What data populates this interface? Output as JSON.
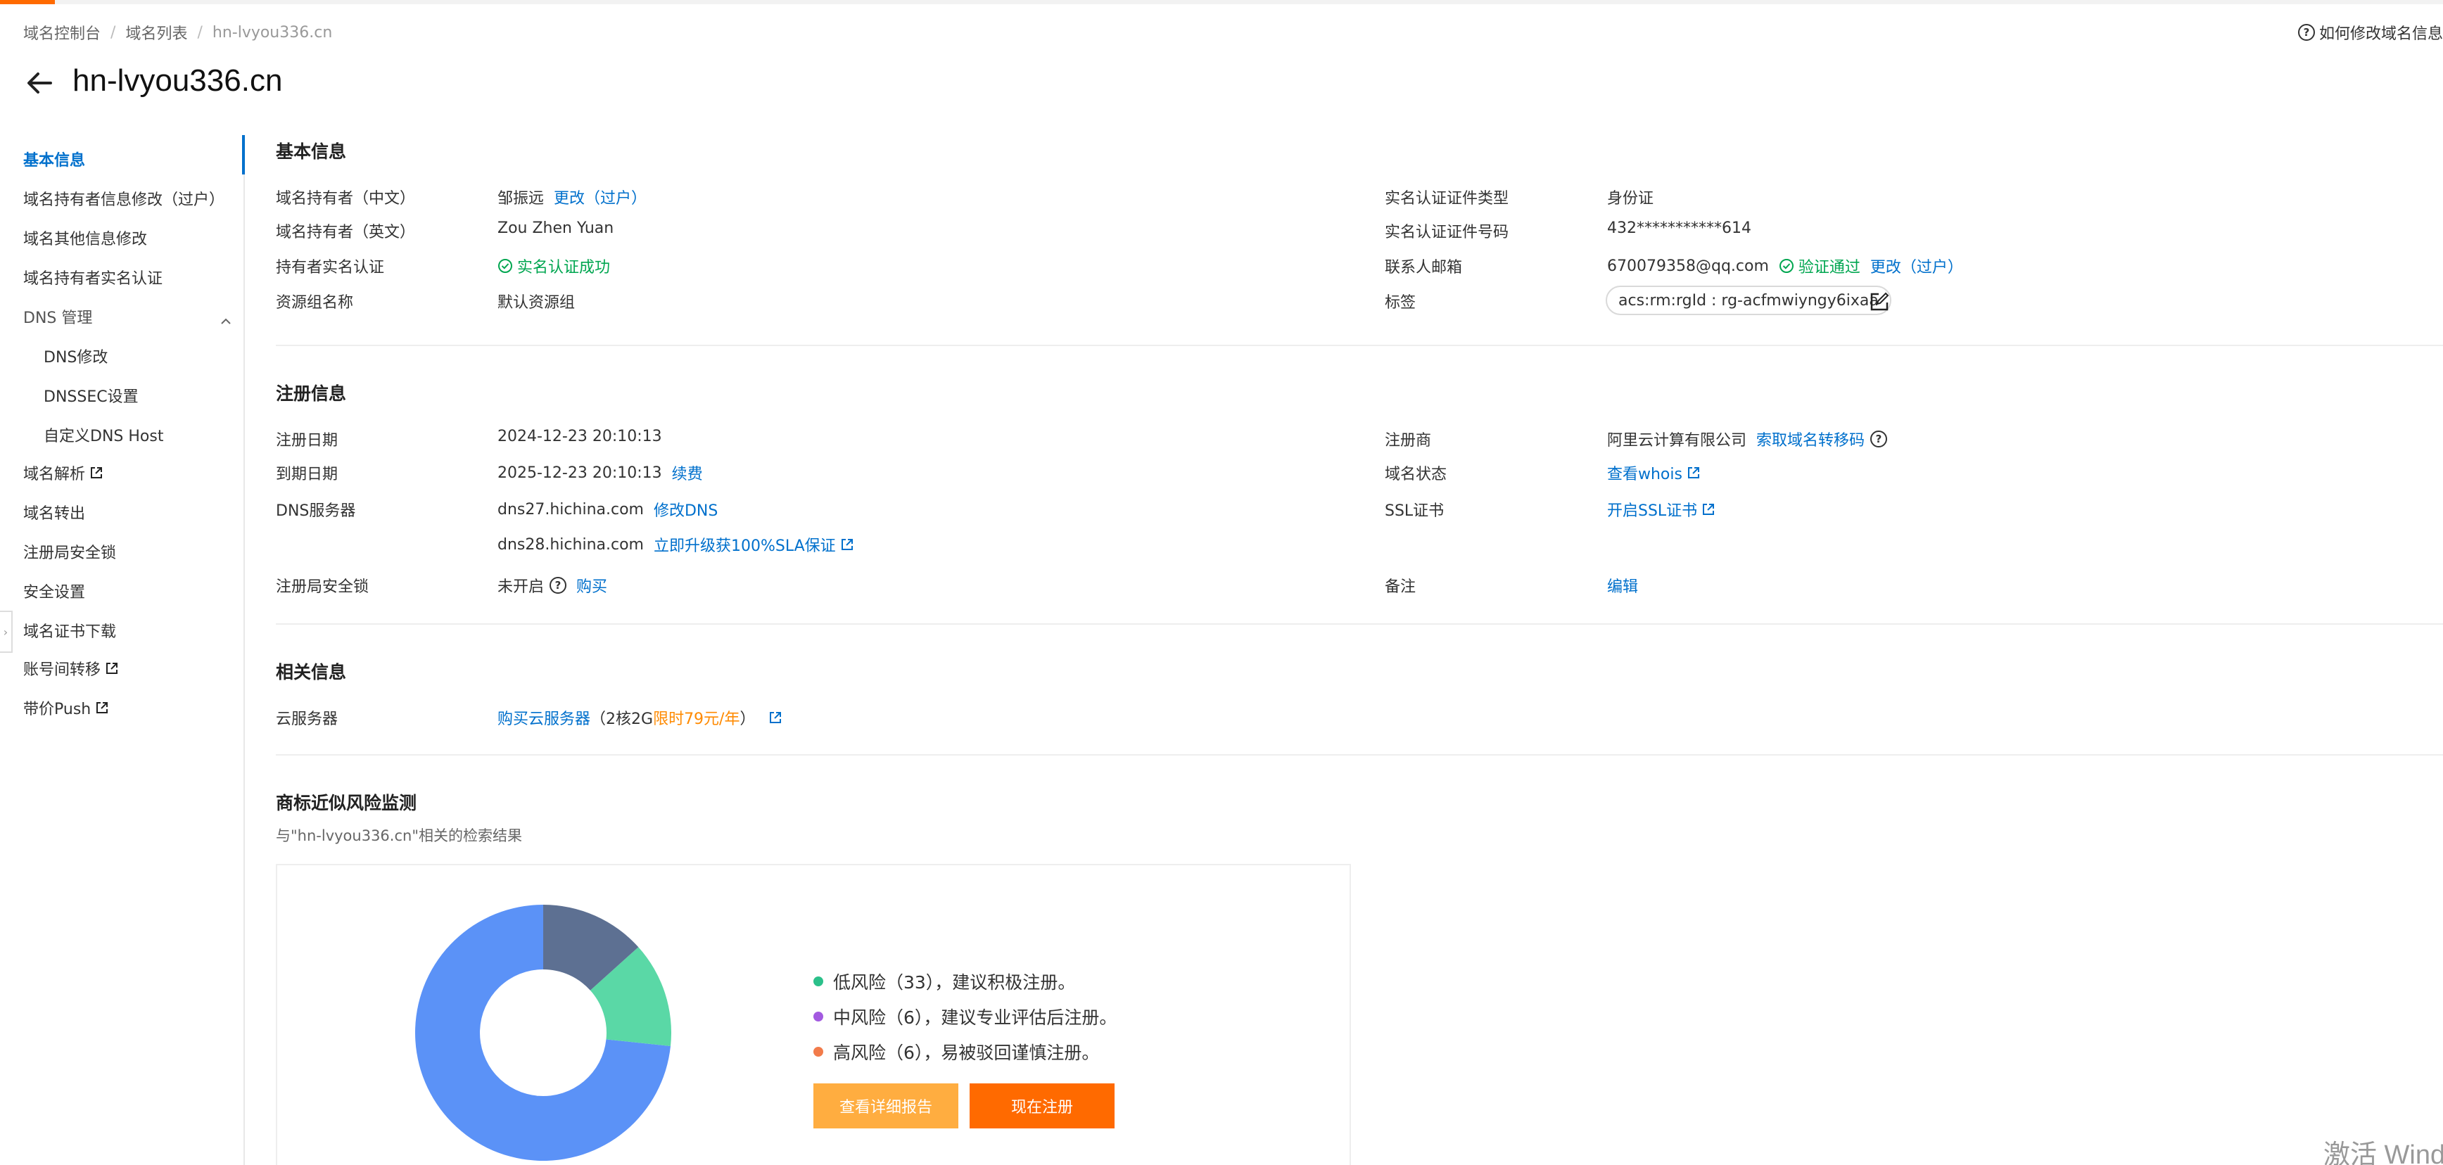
{
  "breadcrumb": [
    "域名控制台",
    "域名列表",
    "hn-lvyou336.cn"
  ],
  "help_link": "如何修改域名信息",
  "page_title": "hn-lvyou336.cn",
  "sidebar": {
    "items": [
      {
        "label": "基本信息",
        "active": true
      },
      {
        "label": "域名持有者信息修改（过户）"
      },
      {
        "label": "域名其他信息修改"
      },
      {
        "label": "域名持有者实名认证"
      },
      {
        "label": "DNS 管理",
        "expanded": true
      },
      {
        "label": "DNS修改",
        "sub": true
      },
      {
        "label": "DNSSEC设置",
        "sub": true
      },
      {
        "label": "自定义DNS Host",
        "sub": true
      },
      {
        "label": "域名解析",
        "external": true
      },
      {
        "label": "域名转出"
      },
      {
        "label": "注册局安全锁"
      },
      {
        "label": "安全设置"
      },
      {
        "label": "域名证书下载"
      },
      {
        "label": "账号间转移",
        "external": true
      },
      {
        "label": "带价Push",
        "external": true
      }
    ]
  },
  "basic": {
    "title": "基本信息",
    "holder_cn_label": "域名持有者（中文）",
    "holder_cn_value": "邹振远",
    "holder_cn_link": "更改（过户）",
    "holder_en_label": "域名持有者（英文）",
    "holder_en_value": "Zou Zhen Yuan",
    "realname_label": "持有者实名认证",
    "realname_value": "实名认证成功",
    "resource_label": "资源组名称",
    "resource_value": "默认资源组",
    "cert_type_label": "实名认证证件类型",
    "cert_type_value": "身份证",
    "cert_no_label": "实名认证证件号码",
    "cert_no_value": "432***********614",
    "email_label": "联系人邮箱",
    "email_value": "670079358@qq.com",
    "email_verified": "验证通过",
    "email_link": "更改（过户）",
    "tag_label": "标签",
    "tag_value": "acs:rm:rgId : rg-acfmwiyngy6ixaa"
  },
  "registration": {
    "title": "注册信息",
    "reg_date_label": "注册日期",
    "reg_date_value": "2024-12-23 20:10:13",
    "exp_date_label": "到期日期",
    "exp_date_value": "2025-12-23 20:10:13",
    "renew_link": "续费",
    "dns_label": "DNS服务器",
    "dns1": "dns27.hichina.com",
    "dns_modify_link": "修改DNS",
    "dns2": "dns28.hichina.com",
    "dns_upgrade_link": "立即升级获100%SLA保证",
    "lock_label": "注册局安全锁",
    "lock_value": "未开启",
    "lock_buy_link": "购买",
    "registrar_label": "注册商",
    "registrar_value": "阿里云计算有限公司",
    "transfer_code_link": "索取域名转移码",
    "status_label": "域名状态",
    "whois_link": "查看whois",
    "ssl_label": "SSL证书",
    "ssl_link": "开启SSL证书",
    "remark_label": "备注",
    "remark_link": "编辑"
  },
  "related": {
    "title": "相关信息",
    "cloud_label": "云服务器",
    "cloud_link": "购买云服务器",
    "cloud_text_pre": "（2核2G",
    "cloud_promo": "限时79元/年",
    "cloud_text_post": "）"
  },
  "trademark": {
    "title": "商标近似风险监测",
    "subtitle": "与\"hn-lvyou336.cn\"相关的检索结果",
    "legend": [
      {
        "label": "低风险（33），建议积极注册。",
        "color": "#2bc08a",
        "value": 33
      },
      {
        "label": "中风险（6），建议专业评估后注册。",
        "color": "#a35ae0",
        "value": 6
      },
      {
        "label": "高风险（6），易被驳回谨慎注册。",
        "color": "#f27b4a",
        "value": 6
      }
    ],
    "report_button": "查看详细报告",
    "register_button": "现在注册"
  },
  "chart_data": {
    "type": "pie",
    "categories": [
      "低风险",
      "中风险",
      "高风险"
    ],
    "values": [
      33,
      6,
      6
    ],
    "colors": [
      "#5b92f7",
      "#5ad8a6",
      "#5d7092"
    ]
  },
  "watermark": "激活 Wind"
}
